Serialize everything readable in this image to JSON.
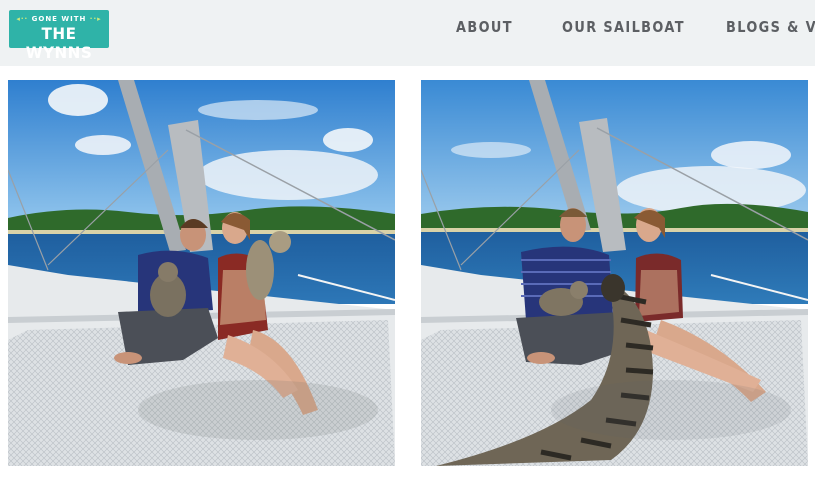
{
  "header": {
    "logo": {
      "small_text": "GONE WITH",
      "big_text": "THE WYNNS",
      "bg_color": "#2fb3a8"
    },
    "nav": [
      {
        "label": "ABOUT"
      },
      {
        "label": "OUR SAILBOAT"
      },
      {
        "label": "BLOGS & VIDEOS"
      }
    ]
  },
  "photos": [
    {
      "name": "couple with cats on catamaran trampoline"
    },
    {
      "name": "couple on catamaran with cat tail in foreground"
    }
  ],
  "colors": {
    "sky": "#3f8fd6",
    "water": "#2367a8",
    "trampoline": "#d8dde0",
    "nav_text": "#5c5f63"
  }
}
